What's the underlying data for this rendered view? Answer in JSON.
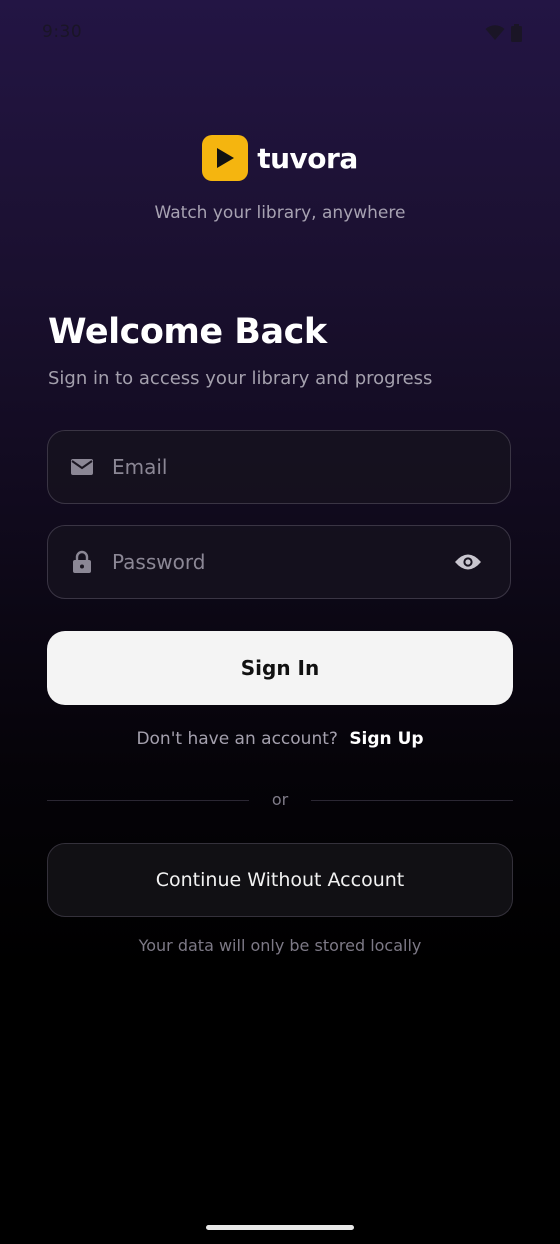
{
  "status_bar": {
    "time": "9:30",
    "icons": [
      "wifi-icon",
      "battery-icon"
    ]
  },
  "brand": {
    "name": "tuvora",
    "logo_icon": "play-icon",
    "logo_color": "#f5b50f",
    "tagline": "Watch your library, anywhere"
  },
  "login": {
    "title": "Welcome Back",
    "subtitle": "Sign in to access your library and progress",
    "email": {
      "placeholder": "Email",
      "value": "",
      "icon": "mail-icon"
    },
    "password": {
      "placeholder": "Password",
      "value": "",
      "icon": "lock-icon",
      "toggle_icon": "eye-icon"
    },
    "sign_in_label": "Sign In",
    "signup_prompt": "Don't have an account?",
    "signup_link": "Sign Up",
    "divider_text": "or",
    "continue_label": "Continue Without Account",
    "local_note": "Your data will only be stored locally"
  },
  "colors": {
    "background_top": "#231544",
    "background_bottom": "#000000",
    "primary_button": "#f4f4f4",
    "accent": "#f5b50f"
  }
}
